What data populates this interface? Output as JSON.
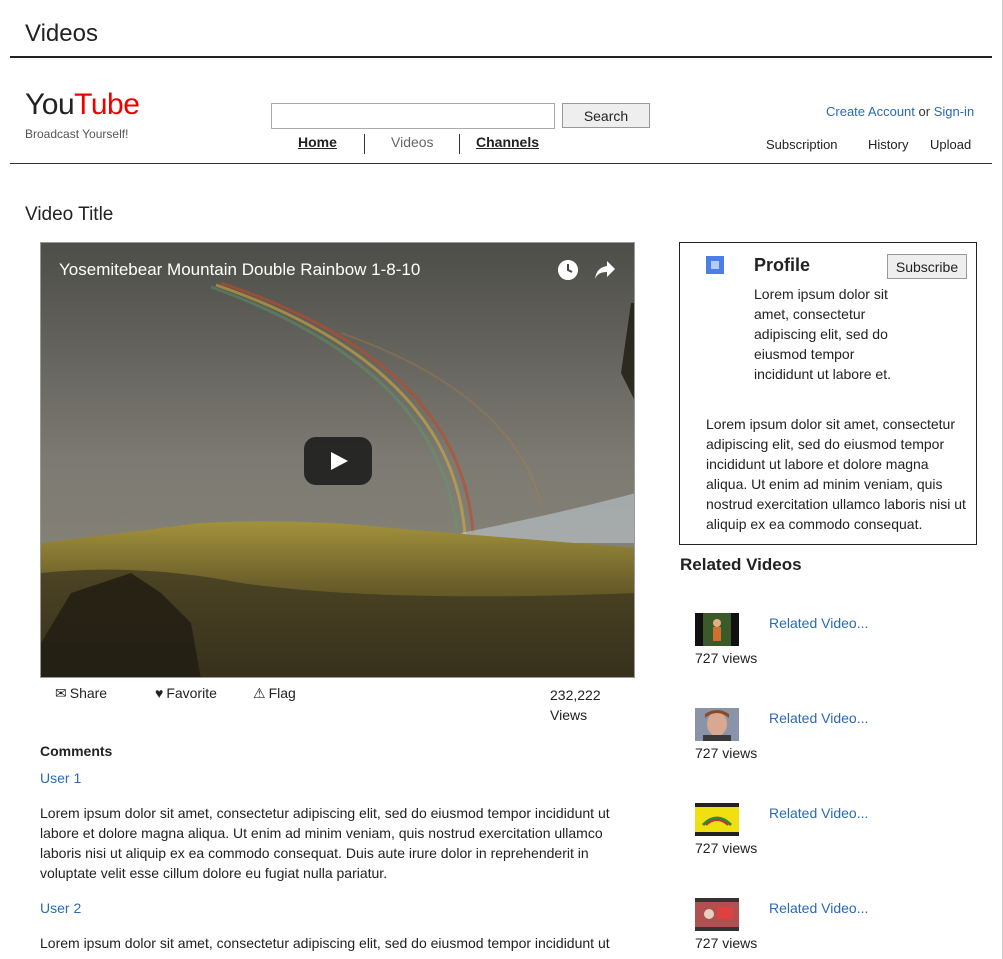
{
  "page": {
    "heading": "Videos"
  },
  "brand": {
    "logo_you": "You",
    "logo_tube": "Tube",
    "tagline": "Broadcast Yourself!"
  },
  "search": {
    "placeholder": "",
    "button_label": "Search"
  },
  "nav": {
    "home": "Home",
    "videos": "Videos",
    "channels": "Channels"
  },
  "account": {
    "create": "Create Account",
    "or": "or",
    "signin": "Sign-in"
  },
  "user_nav": {
    "subscription": "Subscription",
    "history": "History",
    "upload": "Upload"
  },
  "video": {
    "section_title": "Video Title",
    "player_title": "Yosemitebear Mountain Double Rainbow 1-8-10",
    "actions": {
      "share": "Share",
      "favorite": "Favorite",
      "flag": "Flag"
    },
    "views_number": "232,222",
    "views_label": "Views"
  },
  "comments": {
    "label": "Comments",
    "items": [
      {
        "user": "User 1",
        "text": "Lorem ipsum dolor sit amet, consectetur adipiscing elit, sed do eiusmod tempor incididunt ut labore et dolore magna aliqua. Ut enim ad minim veniam, quis nostrud exercitation ullamco laboris nisi ut aliquip ex ea commodo consequat. Duis aute irure dolor in reprehenderit in voluptate velit esse cillum dolore eu fugiat nulla pariatur."
      },
      {
        "user": "User 2",
        "text": "Lorem ipsum dolor sit amet, consectetur adipiscing elit, sed do eiusmod tempor incididunt ut"
      }
    ]
  },
  "profile": {
    "title": "Profile",
    "subscribe_label": "Subscribe",
    "short_text": "Lorem ipsum dolor sit amet, consectetur adipiscing elit, sed do eiusmod tempor incididunt ut labore et.",
    "long_text": "Lorem ipsum dolor sit amet, consectetur adipiscing elit, sed do eiusmod tempor incididunt ut labore et dolore magna aliqua. Ut enim ad minim veniam, quis nostrud exercitation ullamco laboris nisi ut aliquip ex ea commodo consequat."
  },
  "related": {
    "title": "Related Videos",
    "items": [
      {
        "link": "Related Video...",
        "views": "727 views"
      },
      {
        "link": "Related Video...",
        "views": "727 views"
      },
      {
        "link": "Related Video...",
        "views": "727 views"
      },
      {
        "link": "Related Video...",
        "views": "727 views"
      }
    ]
  },
  "colors": {
    "link": "#2a6ab8",
    "brand_red": "#e00"
  }
}
